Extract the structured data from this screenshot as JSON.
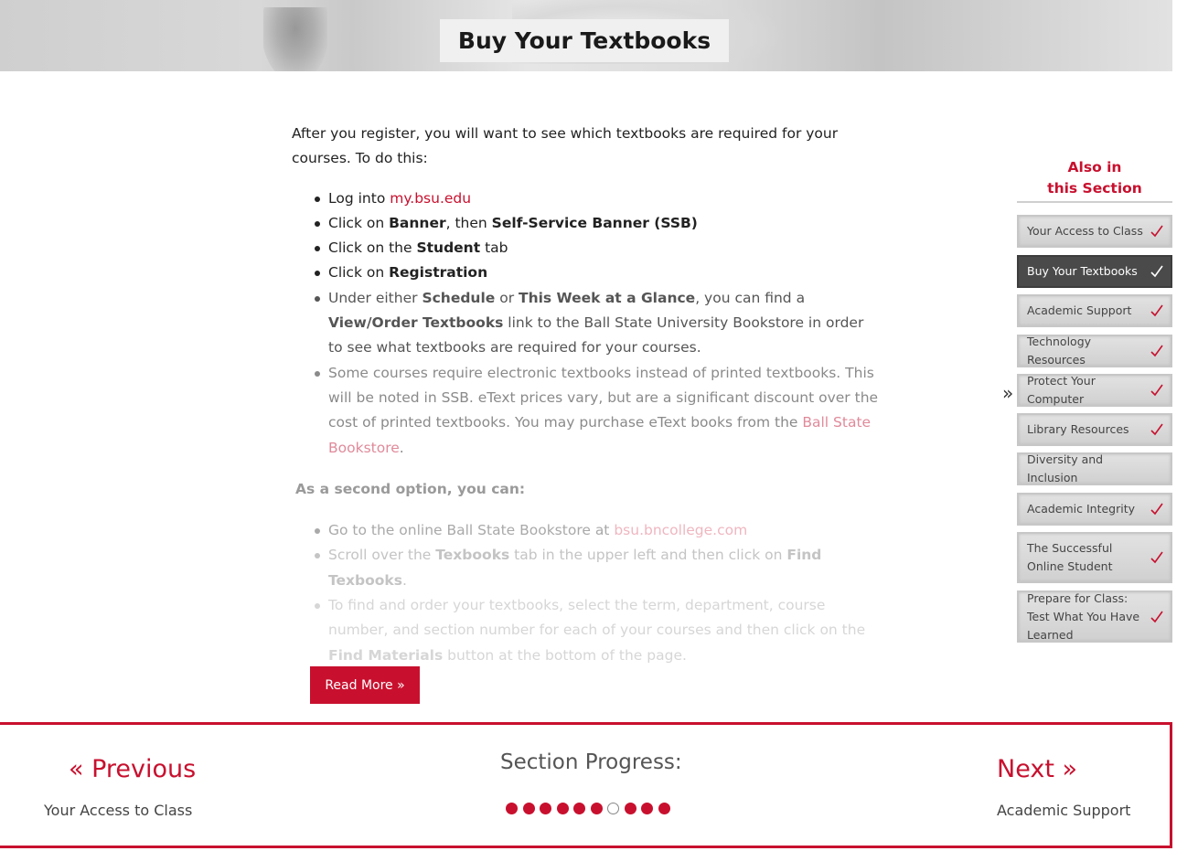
{
  "hero": {
    "title": "Buy Your Textbooks"
  },
  "content": {
    "intro": "After you register, you will want to see which textbooks are required for your courses.  To do this:",
    "steps": {
      "s1_pre": "Log into ",
      "s1_link": "my.bsu.edu",
      "s2_pre": "Click on ",
      "s2_b1": "Banner",
      "s2_mid": ", then ",
      "s2_b2": "Self-Service Banner (SSB)",
      "s3_pre": "Click on the ",
      "s3_b": "Student",
      "s3_post": " tab",
      "s4_pre": "Click on ",
      "s4_b": "Registration",
      "s5_pre": "Under either ",
      "s5_b1": "Schedule",
      "s5_mid1": " or ",
      "s5_b2": "This Week at a Glance",
      "s5_mid2": ", you can find a ",
      "s5_b3": "View/Order Textbooks",
      "s5_post": " link to the Ball State University Bookstore in order to see what textbooks are required for your courses.",
      "s6_pre": "Some courses require electronic textbooks instead of printed textbooks. This will be noted in SSB. eText prices vary, but are a significant discount over the cost of printed textbooks. You may purchase eText books from the ",
      "s6_link": "Ball State Bookstore",
      "s6_post": "."
    },
    "second_option": "As a second option, you can:",
    "option_steps": {
      "o1_pre": "Go to the online Ball State Bookstore at ",
      "o1_link": "bsu.bncollege.com",
      "o2_pre": "Scroll over the ",
      "o2_b1": "Texbooks",
      "o2_mid": " tab in the upper left and then click on ",
      "o2_b2": "Find Texbooks",
      "o2_post": ".",
      "o3_pre": "To find and order your textbooks, select the term, department, course number, and section number for each of your courses and then click on the ",
      "o3_b": "Find Materials",
      "o3_post": " button at the bottom of the page."
    },
    "read_more": "Read More »"
  },
  "sidebar": {
    "heading_line1": "Also in",
    "heading_line2": "this Section",
    "current_marker": "»",
    "items": [
      {
        "label": "Your Access to Class",
        "checked": true
      },
      {
        "label": "Buy Your Textbooks",
        "checked": true,
        "active": true
      },
      {
        "label": "Academic Support",
        "checked": true
      },
      {
        "label": "Technology Resources",
        "checked": true
      },
      {
        "label": "Protect Your Computer",
        "checked": true
      },
      {
        "label": "Library Resources",
        "checked": true
      },
      {
        "label": "Diversity and Inclusion",
        "checked": false
      },
      {
        "label": "Academic Integrity",
        "checked": true
      },
      {
        "label": "The Successful Online Student",
        "checked": true
      },
      {
        "label": "Prepare for Class: Test What You Have Learned",
        "checked": true
      }
    ]
  },
  "footer": {
    "prev_label": "« Previous",
    "prev_title": "Your Access to Class",
    "progress_label": "Section Progress:",
    "progress_completed": [
      true,
      true,
      true,
      true,
      true,
      true,
      false,
      true,
      true,
      true
    ],
    "next_label": "Next »",
    "next_title": "Academic Support"
  },
  "colors": {
    "accent": "#c8102e",
    "active_item_bg": "#4a4a4a",
    "item_bg": "#d6d6d6"
  }
}
